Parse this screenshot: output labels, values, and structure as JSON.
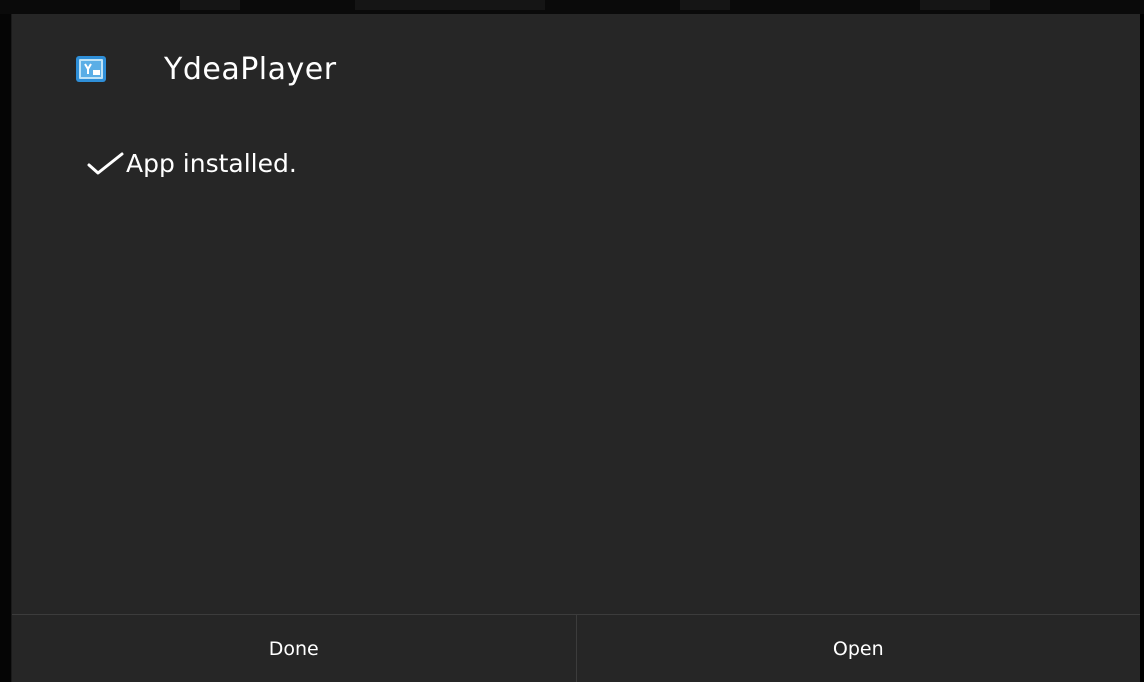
{
  "dialog": {
    "app_name": "YdeaPlayer",
    "app_icon": "app-icon",
    "status_icon": "checkmark-icon",
    "status_text": "App installed."
  },
  "buttons": {
    "done_label": "Done",
    "open_label": "Open"
  },
  "colors": {
    "dialog_background": "#262626",
    "text": "#ffffff",
    "divider": "#3c3c3c",
    "icon_blue": "#2f8fd8"
  }
}
